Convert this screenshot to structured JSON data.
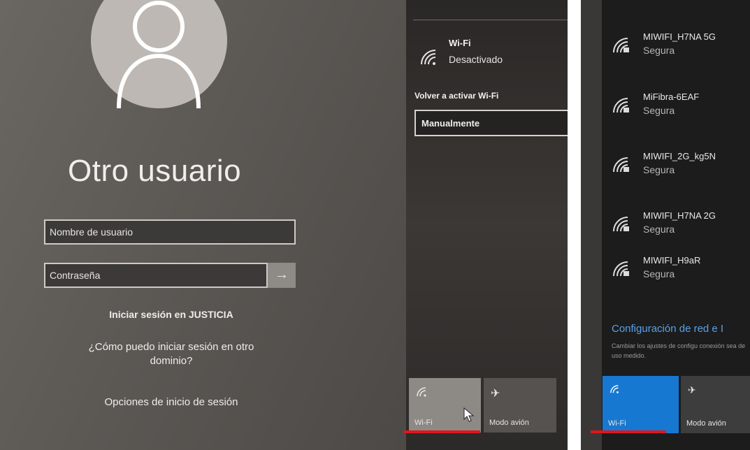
{
  "lock_screen": {
    "user_title": "Otro usuario",
    "username_placeholder": "Nombre de usuario",
    "password_placeholder": "Contraseña",
    "signin_justicia": "Iniciar sesión en JUSTICIA",
    "other_domain": "¿Cómo puedo iniciar sesión en otro dominio?",
    "signin_options": "Opciones de inicio de sesión"
  },
  "network_flyout": {
    "wifi_title": "Wi-Fi",
    "wifi_status": "Desactivado",
    "reactivate_label": "Volver a activar Wi-Fi",
    "reactivate_value": "Manualmente",
    "tiles": [
      {
        "label": "Wi-Fi",
        "icon": "wifi-icon"
      },
      {
        "label": "Modo avión",
        "icon": "airplane-icon"
      }
    ]
  },
  "wifi_list": {
    "networks": [
      {
        "name": "MIWIFI_H7NA 5G",
        "status": "Segura"
      },
      {
        "name": "MiFibra-6EAF",
        "status": "Segura"
      },
      {
        "name": "MIWIFI_2G_kg5N",
        "status": "Segura"
      },
      {
        "name": "MIWIFI_H7NA 2G",
        "status": "Segura"
      },
      {
        "name": "MIWIFI_H9aR",
        "status": "Segura"
      }
    ],
    "settings_title": "Configuración de red e I",
    "settings_desc": "Cambiar los ajustes de configu conexión sea de uso medido.",
    "tiles": [
      {
        "label": "Wi-Fi",
        "icon": "wifi-icon"
      },
      {
        "label": "Modo avión",
        "icon": "airplane-icon"
      }
    ]
  },
  "colors": {
    "accent_blue": "#1778d2",
    "link_blue": "#5aa0e8",
    "highlight_red": "#e0161d"
  }
}
